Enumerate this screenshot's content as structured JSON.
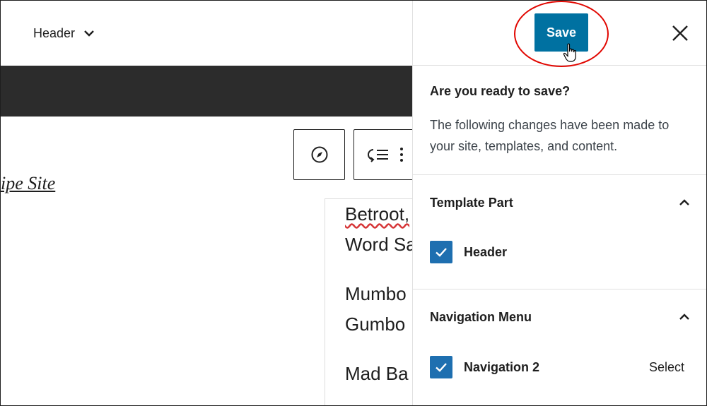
{
  "editor": {
    "template_selector_label": "Header",
    "site_title": "ipe Site",
    "nav_items": [
      {
        "line1": "Betroot,",
        "line2": "Word Sa"
      },
      {
        "line1": "Mumbo",
        "line2": "Gumbo"
      },
      {
        "line1": "Mad Ba",
        "line2": ""
      }
    ]
  },
  "panel": {
    "save_label": "Save",
    "heading": "Are you ready to save?",
    "description": "The following changes have been made to your site, templates, and content.",
    "sections": [
      {
        "title": "Template Part",
        "item_label": "Header",
        "checked": true
      },
      {
        "title": "Navigation Menu",
        "item_label": "Navigation 2",
        "checked": true,
        "action_label": "Select"
      }
    ]
  },
  "colors": {
    "primary_button": "#0071a1",
    "checkbox": "#1e6fb0",
    "annotation_ring": "#e10600",
    "dark_bar": "#2c2c2c"
  },
  "icons": [
    "chevron-down-icon",
    "compass-icon",
    "list-view-icon",
    "more-vertical-icon",
    "close-icon",
    "chevron-up-icon",
    "checkmark-icon",
    "hand-pointer-icon"
  ]
}
